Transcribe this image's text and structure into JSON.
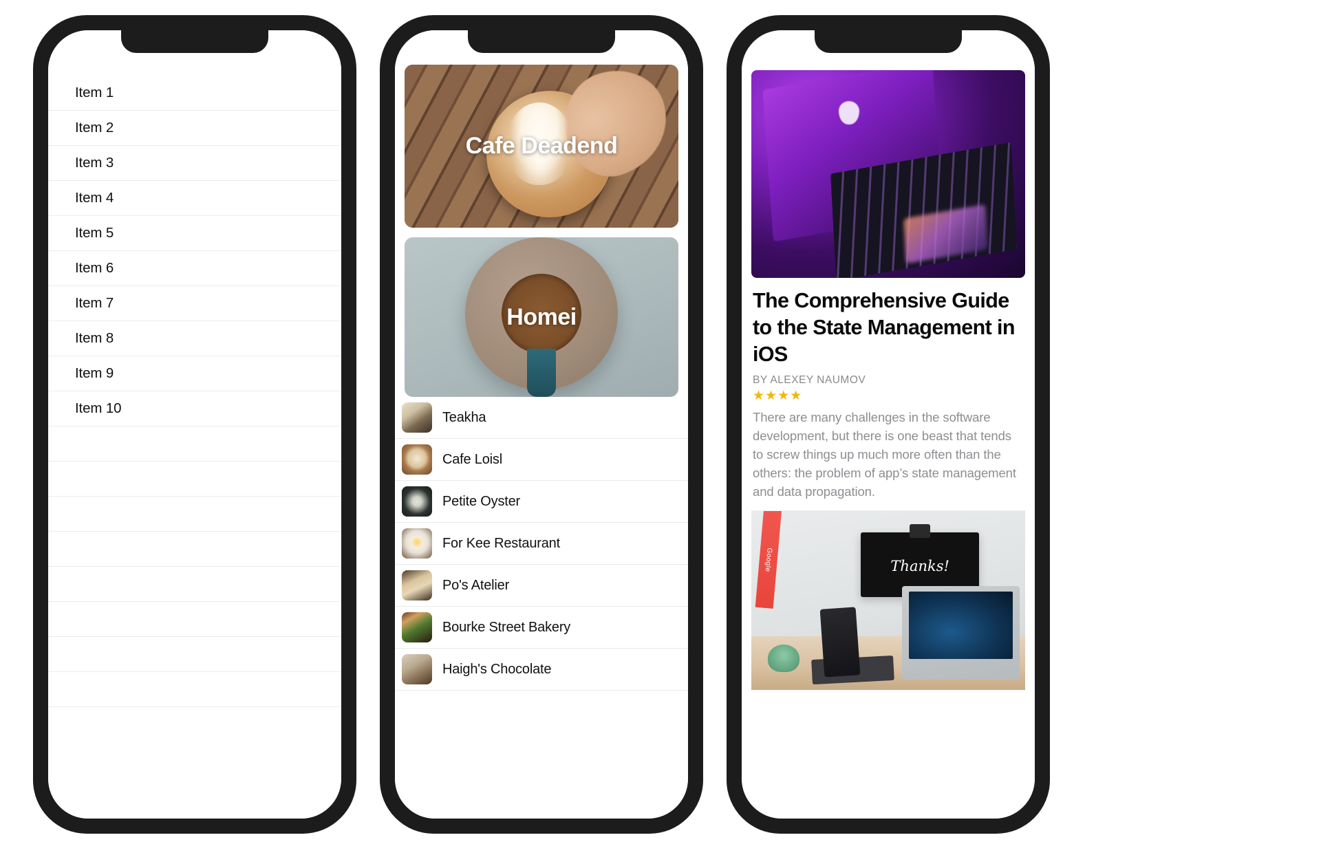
{
  "phone_1": {
    "name": "plain-list-screen",
    "items": [
      "Item 1",
      "Item 2",
      "Item 3",
      "Item 4",
      "Item 5",
      "Item 6",
      "Item 7",
      "Item 8",
      "Item 9",
      "Item 10"
    ],
    "empty_rows": 8
  },
  "phone_2": {
    "name": "restaurant-feed-screen",
    "hero_cards": [
      {
        "label": "Cafe Deadend",
        "image": "latte-art-on-wooden-table-photo"
      },
      {
        "label": "Homei",
        "image": "coffee-cup-top-down-photo"
      }
    ],
    "list_items": [
      {
        "name": "Teakha",
        "thumb": "teapot-thumbnail"
      },
      {
        "name": "Cafe Loisl",
        "thumb": "latte-thumbnail"
      },
      {
        "name": "Petite Oyster",
        "thumb": "oyster-platter-thumbnail"
      },
      {
        "name": "For Kee Restaurant",
        "thumb": "fried-egg-plate-thumbnail"
      },
      {
        "name": "Po's Atelier",
        "thumb": "bread-loaf-thumbnail"
      },
      {
        "name": "Bourke Street Bakery",
        "thumb": "sandwich-and-drink-thumbnail"
      },
      {
        "name": "Haigh's Chocolate",
        "thumb": "chocolate-thumbnail"
      }
    ]
  },
  "phone_3": {
    "name": "article-screen",
    "hero_image": "purple-backlit-macbook-photo",
    "title": "The Comprehensive Guide to the State Management in iOS",
    "byline": "BY ALEXEY NAUMOV",
    "rating": 4,
    "stars_glyph": "★★★★",
    "body": "There are many challenges in the software development, but there is one beast that tends to screw things up much more often than the others: the problem of app’s state management and data propagation.",
    "second_image": "desk-with-thanks-sign-photo",
    "second_image_texts": {
      "lanyard": "Google",
      "sign": "Thanks!"
    }
  },
  "colors": {
    "frame": "#1c1c1c",
    "screen_bg": "#ffffff",
    "separator": "#ececec",
    "primary_text": "#111111",
    "secondary_text": "#8e8e93",
    "star": "#f2b705",
    "hero_label": "#ffffff"
  }
}
